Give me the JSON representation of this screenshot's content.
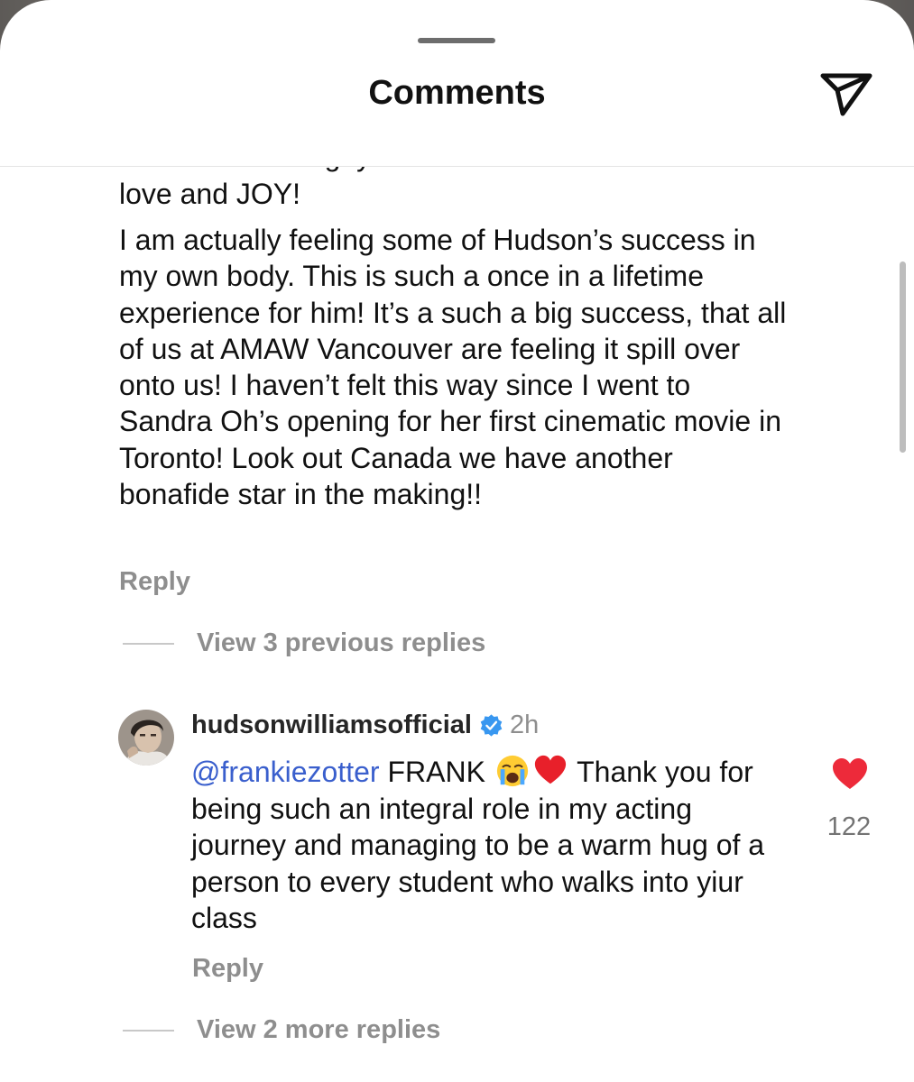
{
  "header": {
    "title": "Comments",
    "share_icon": "send-icon"
  },
  "comment": {
    "text_partial_top": "THIRSTING for gay stories that had authentic",
    "text_line_2": "love and JOY!",
    "text_paragraph": "I am actually feeling some of Hudson’s success in my own body. This is such a once in a lifetime experience for him! It’s a such a big success, that all of us at AMAW Vancouver are feeling it spill over onto us! I haven’t felt this way since I went to Sandra Oh’s opening for her first cinematic movie in Toronto! Look out Canada we have another bonafide star in the making!!",
    "reply_label": "Reply",
    "view_previous_replies": "View 3 previous replies"
  },
  "reply": {
    "username": "hudsonwilliamsofficial",
    "verified_icon": "verified-badge-icon",
    "time": "2h",
    "mention": "@frankiezotter",
    "text_before_emoji": "FRANK",
    "emoji_1": "loudly-crying-face-emoji",
    "emoji_2": "red-heart-emoji",
    "text_after_emoji": "Thank you for being such an integral role in my acting journey and managing to be a warm hug of a person to every student who walks into yiur class",
    "reply_label": "Reply",
    "like_icon": "heart-filled-icon",
    "like_count": "122",
    "like_color": "#ed2a3a",
    "view_more_replies": "View 2 more replies"
  },
  "colors": {
    "mention": "#3a5fcd",
    "secondary_text": "#8e8e8e",
    "verified": "#3897f0"
  }
}
